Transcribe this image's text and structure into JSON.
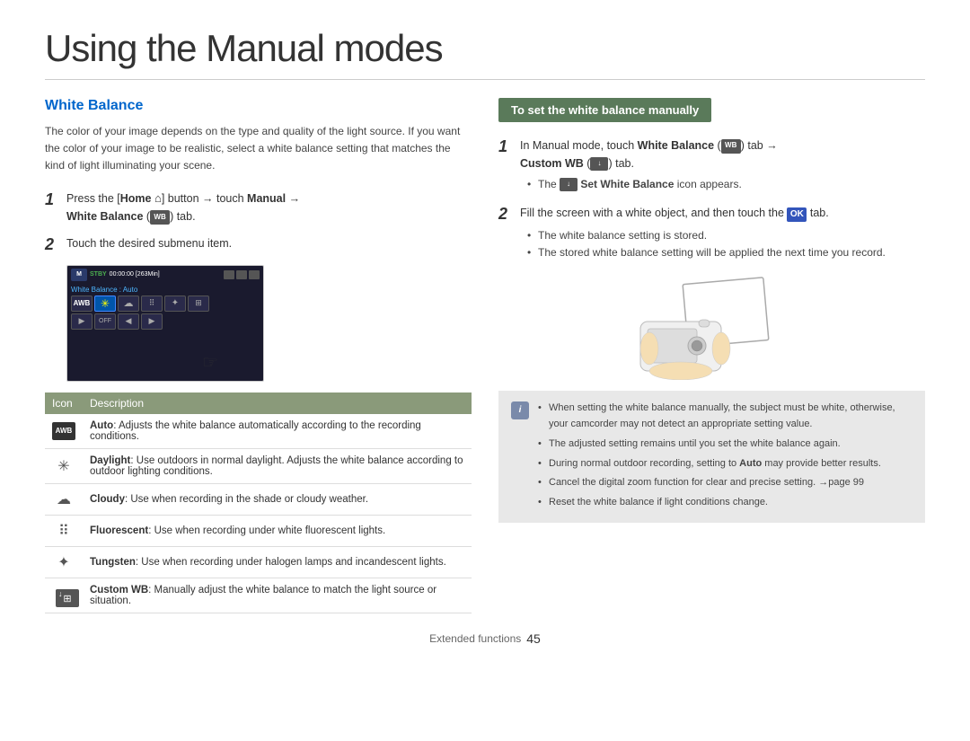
{
  "page": {
    "title": "Using the Manual modes",
    "footer_label": "Extended functions",
    "footer_page": "45"
  },
  "left": {
    "section_title": "White Balance",
    "intro": "The color of your image depends on the type and quality of the light source. If you want the color of your image to be realistic, select a white balance setting that matches the kind of light illuminating your scene.",
    "step1_text": "Press the [Home",
    "step1_middle": "] button → touch Manual →",
    "step1_end": "White Balance (",
    "step1_end2": ") tab.",
    "step2_text": "Touch the desired submenu item.",
    "wb_label": "White Balance : Auto",
    "table_col1": "Icon",
    "table_col2": "Description",
    "rows": [
      {
        "icon_type": "awb",
        "title": "Auto",
        "desc": ": Adjusts the white balance automatically according to the recording conditions."
      },
      {
        "icon_type": "sun",
        "title": "Daylight",
        "desc": ": Use outdoors in normal daylight. Adjusts the white balance according to outdoor lighting conditions."
      },
      {
        "icon_type": "cloud",
        "title": "Cloudy",
        "desc": ": Use when recording in the shade or cloudy weather."
      },
      {
        "icon_type": "fluor",
        "title": "Fluorescent",
        "desc": ": Use when recording under white fluorescent lights."
      },
      {
        "icon_type": "tungsten",
        "title": "Tungsten",
        "desc": ": Use when recording under halogen lamps and incandescent lights."
      },
      {
        "icon_type": "custom",
        "title": "Custom WB",
        "desc": ": Manually adjust the white balance to match the light source or situation."
      }
    ]
  },
  "right": {
    "header": "To set the white balance manually",
    "step1": {
      "num": "1",
      "text": "In Manual mode, touch ",
      "bold1": "White Balance",
      "tab_label": "WB",
      "middle": ") tab →",
      "bold2": "Custom WB (",
      "custom_icon": "↓",
      "end": ") tab."
    },
    "step1_bullet": "The",
    "step1_bullet_bold": "Set White Balance",
    "step1_bullet_end": "icon appears.",
    "step2": {
      "num": "2",
      "text": "Fill the screen with a white object, and then touch the",
      "ok_label": "OK",
      "end": "tab."
    },
    "step2_bullets": [
      "The white balance setting is stored.",
      "The stored white balance setting will be applied the next time you record."
    ],
    "note_bullets": [
      "When setting the white balance manually, the subject must be white, otherwise, your camcorder may not detect an appropriate setting value.",
      "The adjusted setting remains until you set the white balance again.",
      "During normal outdoor recording, setting to Auto may provide better results.",
      "Cancel the digital zoom function for clear and precise setting. →page 99",
      "Reset the white balance if light conditions change."
    ]
  }
}
